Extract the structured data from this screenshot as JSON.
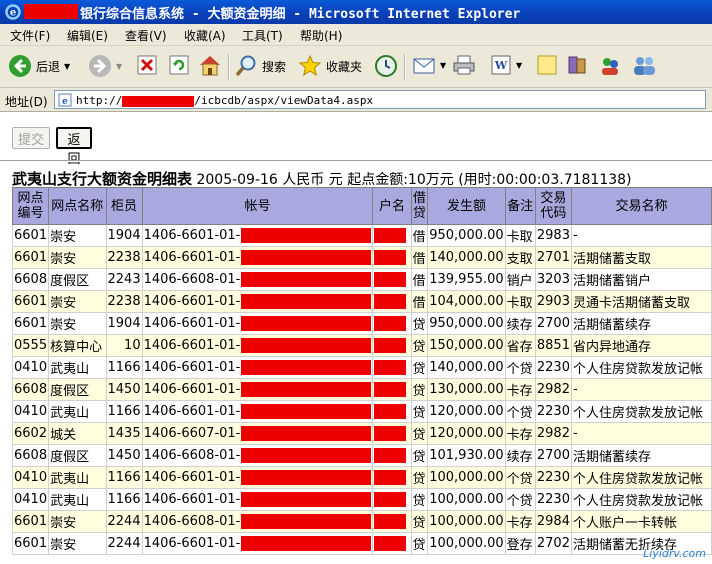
{
  "window": {
    "title": "银行综合信息系统 - 大额资金明细 - Microsoft Internet Explorer"
  },
  "menu": [
    "文件(F)",
    "编辑(E)",
    "查看(V)",
    "收藏(A)",
    "工具(T)",
    "帮助(H)"
  ],
  "toolbar": {
    "back_label": "后退",
    "search_label": "搜索",
    "favorites_label": "收藏夹"
  },
  "address": {
    "label": "地址(D)",
    "prefix": "http://",
    "suffix": "/icbcdb/aspx/viewData4.aspx"
  },
  "buttons": {
    "submit": "提交",
    "back": "返回"
  },
  "report": {
    "title": "武夷山支行大额资金明细表",
    "date": "2005-09-16",
    "currency": "人民币",
    "unit": "元",
    "threshold": "起点金额:10万元",
    "elapsed": "(用时:00:00:03.7181138)"
  },
  "table": {
    "headers": [
      "网点编号",
      "网点名称",
      "柜员",
      "帐号",
      "户名",
      "借贷",
      "发生额",
      "备注",
      "交易代码",
      "交易名称"
    ],
    "rows": [
      {
        "branch_id": "6601",
        "branch": "崇安",
        "teller": "1904",
        "account": "1406-6601-01-",
        "dc": "借",
        "amount": "950,000.00",
        "note": "卡取",
        "code": "2983",
        "name": "-"
      },
      {
        "branch_id": "6601",
        "branch": "崇安",
        "teller": "2238",
        "account": "1406-6601-01-",
        "dc": "借",
        "amount": "140,000.00",
        "note": "支取",
        "code": "2701",
        "name": "活期储蓄支取"
      },
      {
        "branch_id": "6608",
        "branch": "度假区",
        "teller": "2243",
        "account": "1406-6608-01-",
        "dc": "借",
        "amount": "139,955.00",
        "note": "销户",
        "code": "3203",
        "name": "活期储蓄销户"
      },
      {
        "branch_id": "6601",
        "branch": "崇安",
        "teller": "2238",
        "account": "1406-6601-01-",
        "dc": "借",
        "amount": "104,000.00",
        "note": "卡取",
        "code": "2903",
        "name": "灵通卡活期储蓄支取"
      },
      {
        "branch_id": "6601",
        "branch": "崇安",
        "teller": "1904",
        "account": "1406-6601-01-",
        "dc": "贷",
        "amount": "950,000.00",
        "note": "续存",
        "code": "2700",
        "name": "活期储蓄续存"
      },
      {
        "branch_id": "0555",
        "branch": "核算中心",
        "teller": "10",
        "account": "1406-6601-01-",
        "dc": "贷",
        "amount": "150,000.00",
        "note": "省存",
        "code": "8851",
        "name": "省内异地通存"
      },
      {
        "branch_id": "0410",
        "branch": "武夷山",
        "teller": "1166",
        "account": "1406-6601-01-",
        "dc": "贷",
        "amount": "140,000.00",
        "note": "个贷",
        "code": "2230",
        "name": "个人住房贷款发放记帐"
      },
      {
        "branch_id": "6608",
        "branch": "度假区",
        "teller": "1450",
        "account": "1406-6601-01-",
        "dc": "贷",
        "amount": "130,000.00",
        "note": "卡存",
        "code": "2982",
        "name": "-"
      },
      {
        "branch_id": "0410",
        "branch": "武夷山",
        "teller": "1166",
        "account": "1406-6601-01-",
        "dc": "贷",
        "amount": "120,000.00",
        "note": "个贷",
        "code": "2230",
        "name": "个人住房贷款发放记帐"
      },
      {
        "branch_id": "6602",
        "branch": "城关",
        "teller": "1435",
        "account": "1406-6607-01-",
        "dc": "贷",
        "amount": "120,000.00",
        "note": "卡存",
        "code": "2982",
        "name": "-"
      },
      {
        "branch_id": "6608",
        "branch": "度假区",
        "teller": "1450",
        "account": "1406-6608-01-",
        "dc": "贷",
        "amount": "101,930.00",
        "note": "续存",
        "code": "2700",
        "name": "活期储蓄续存"
      },
      {
        "branch_id": "0410",
        "branch": "武夷山",
        "teller": "1166",
        "account": "1406-6601-01-",
        "dc": "贷",
        "amount": "100,000.00",
        "note": "个贷",
        "code": "2230",
        "name": "个人住房贷款发放记帐"
      },
      {
        "branch_id": "0410",
        "branch": "武夷山",
        "teller": "1166",
        "account": "1406-6601-01-",
        "dc": "贷",
        "amount": "100,000.00",
        "note": "个贷",
        "code": "2230",
        "name": "个人住房贷款发放记帐"
      },
      {
        "branch_id": "6601",
        "branch": "崇安",
        "teller": "2244",
        "account": "1406-6608-01-",
        "dc": "贷",
        "amount": "100,000.00",
        "note": "卡存",
        "code": "2984",
        "name": "个人账户一卡转帐"
      },
      {
        "branch_id": "6601",
        "branch": "崇安",
        "teller": "2244",
        "account": "1406-6601-01-",
        "dc": "贷",
        "amount": "100,000.00",
        "note": "登存",
        "code": "2702",
        "name": "活期储蓄无折续存"
      }
    ]
  },
  "watermark": "Liyidrv.com"
}
